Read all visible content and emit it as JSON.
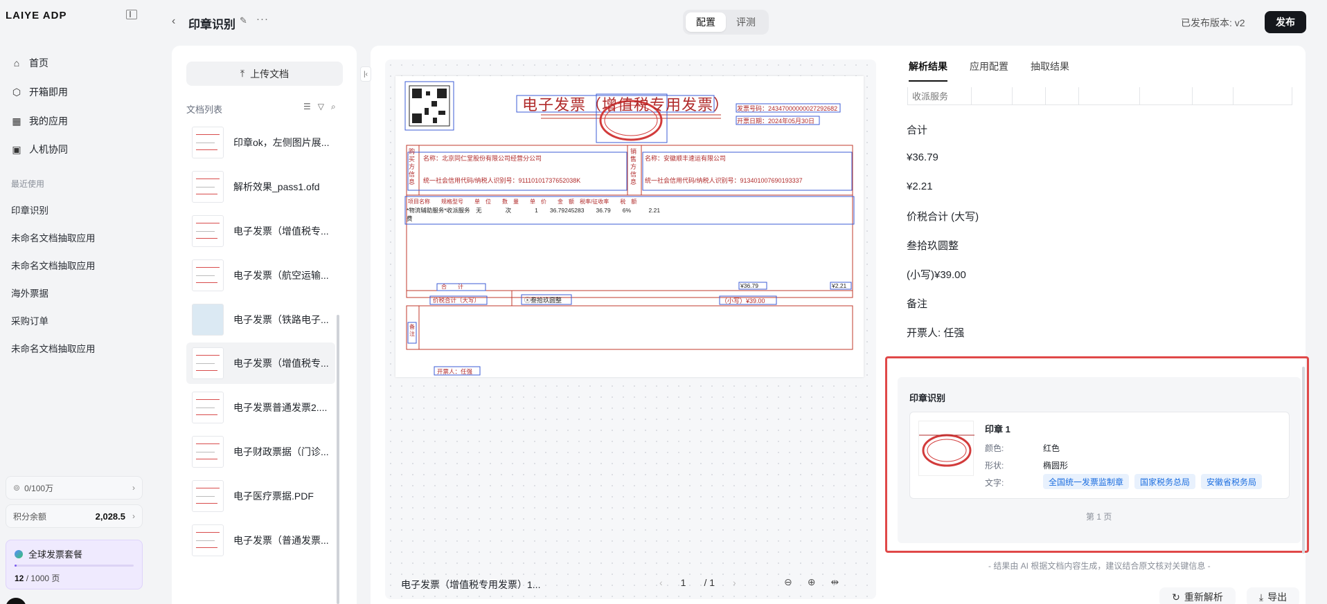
{
  "sidebar": {
    "logo": "LAIYE ADP",
    "nav": [
      {
        "label": "首页",
        "icon": "home-icon"
      },
      {
        "label": "开箱即用",
        "icon": "cube-icon"
      },
      {
        "label": "我的应用",
        "icon": "grid-icon"
      },
      {
        "label": "人机协同",
        "icon": "clipboard-icon"
      }
    ],
    "recent_title": "最近使用",
    "recent": [
      "印章识别",
      "未命名文档抽取应用",
      "未命名文档抽取应用",
      "海外票据",
      "采购订单",
      "未命名文档抽取应用"
    ],
    "quota": "0/100万",
    "credit_label": "积分余额",
    "credit_value": "2,028.5",
    "plan_name": "全球发票套餐",
    "plan_used": "12",
    "plan_total": "/ 1000 页",
    "plan_progress": 0.012
  },
  "header": {
    "title": "印章识别",
    "seg": [
      "配置",
      "评测"
    ],
    "version": "已发布版本: v2",
    "publish": "发布"
  },
  "doclist": {
    "upload": "上传文档",
    "title": "文档列表",
    "items": [
      "印章ok，左侧图片展...",
      "解析效果_pass1.ofd",
      "电子发票（增值税专...",
      "电子发票（航空运输...",
      "电子发票（铁路电子...",
      "电子发票（增值税专...",
      "电子发票普通发票2....",
      "电子财政票据（门诊...",
      "电子医疗票据.PDF",
      "电子发票（普通发票..."
    ]
  },
  "viewer": {
    "file_name": "电子发票（增值税专用发票）1...",
    "page_current": "1",
    "page_total": "/ 1",
    "invoice": {
      "title": "电子发票（增值税专用发票）",
      "no_label": "发票号码：24347000000027292682",
      "date_label": "开票日期：2024年05月30日",
      "buyer_name": "名称：北京同仁堂股份有限公司经营分公司",
      "buyer_tax": "统一社会信用代码/纳税人识别号：91110101737652038K",
      "seller_name": "名称：安徽顺丰速运有限公司",
      "seller_tax": "统一社会信用代码/纳税人识别号：913401007690193337",
      "buyer_side": "购买方信息",
      "seller_side": "销售方信息",
      "items_header": "项目名称　　规格型号　　单　位　　数　量　　单　价　　金　额　税率/征收率　　税　额",
      "items_row": "*物流辅助服务*收派服务　无　　　　次　　　　1　　36.79245283　　36.79　　6%　　　2.21",
      "items_row2": "费",
      "total_label": "合　　计",
      "total_amount": "¥36.79",
      "total_tax": "¥2.21",
      "sum_label": "价税合计（大写）",
      "sum_cn": "ⓧ叁拾玖圆整",
      "sum_num": "（小写）¥39.00",
      "remark": "备注",
      "issuer": "开票人：任强"
    }
  },
  "results": {
    "tabs": [
      "解析结果",
      "应用配置",
      "抽取结果"
    ],
    "strip_text": "收派服务",
    "lines": [
      "合计",
      "¥36.79",
      "¥2.21",
      "价税合计 (大写)",
      "叁拾玖圆整",
      "(小写)¥39.00",
      "备注",
      "开票人: 任强"
    ],
    "seal_section": "印章识别",
    "seal_name": "印章 1",
    "color_label": "颜色:",
    "color_value": "红色",
    "shape_label": "形状:",
    "shape_value": "椭圆形",
    "text_label": "文字:",
    "tags": [
      "全国统一发票监制章",
      "国家税务总局",
      "安徽省税务局"
    ],
    "page_no": "第 1 页",
    "disclaimer": "- 结果由 AI 根据文档内容生成，建议结合原文核对关键信息 -",
    "reparse": "重新解析",
    "export": "导出"
  },
  "colors": {
    "accent": "#15171c",
    "highlight": "#e04848",
    "tag_bg": "#e8f1fd",
    "tag_fg": "#1d6fe0"
  }
}
